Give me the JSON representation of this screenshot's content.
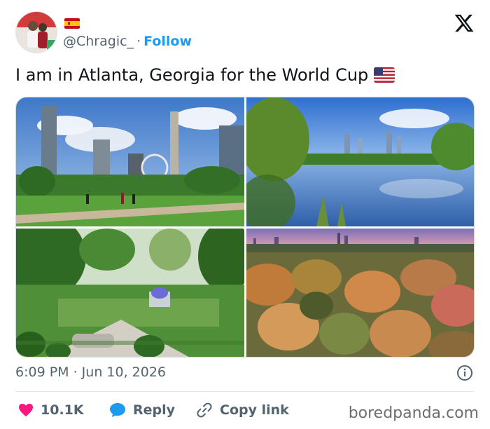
{
  "tweet": {
    "handle": "@Chragic_",
    "separator": "·",
    "follow_label": "Follow",
    "text": "I am in Atlanta, Georgia for the World Cup",
    "timestamp": "6:09 PM · Jun 10, 2026"
  },
  "actions": {
    "likes": "10.1K",
    "reply_label": "Reply",
    "copy_link_label": "Copy link"
  },
  "watermark": "boredpanda.com",
  "photos": [
    {
      "subject": "Centennial Olympic Park with skyline"
    },
    {
      "subject": "Piedmont Park lake reflecting skyline"
    },
    {
      "subject": "Atlanta Botanical Garden"
    },
    {
      "subject": "Autumn forest with city skyline at dusk"
    }
  ],
  "icons": {
    "brand": "x-logo-icon",
    "info": "info-icon",
    "like": "heart-icon",
    "reply": "reply-bubble-icon",
    "copy": "link-icon"
  },
  "colors": {
    "text": "#0f1419",
    "secondary": "#536471",
    "follow": "#1d9bf0",
    "like": "#f91880",
    "reply": "#1d9bf0"
  }
}
